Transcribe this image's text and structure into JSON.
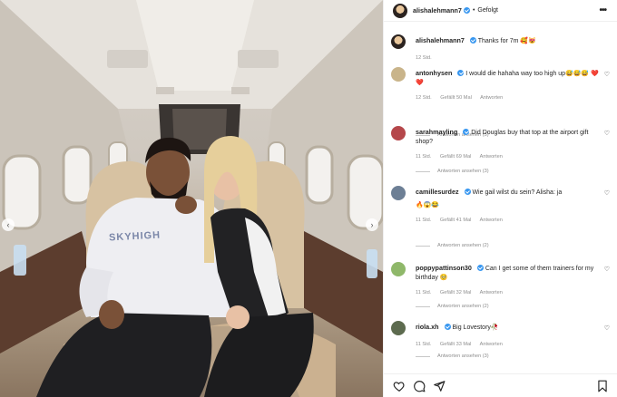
{
  "post": {
    "author": "alishalehmann7",
    "follow_status": "Gefolgt",
    "separator": "•",
    "more_icon": "more-options-icon",
    "shirt_print": "SKYHIGH"
  },
  "caption": {
    "user": "alishalehmann7",
    "text": "Thanks for 7m 🥰😻",
    "time": "12 Std."
  },
  "comments": [
    {
      "user": "antonhysen",
      "verified": true,
      "text": "I would die hahaha way too high up😅😅😅 ❤️❤️",
      "time": "12 Std.",
      "likes": "Gefällt 50 Mal",
      "reply": "Antworten",
      "view_replies": "Antworten ansehen (5)",
      "avatar_color": "#c9b48a"
    },
    {
      "user": "sarahmayling",
      "verified": true,
      "text": "Did Douglas buy that top at the airport gift shop?",
      "time": "11 Std.",
      "likes": "Gefällt 69 Mal",
      "reply": "Antworten",
      "view_replies": "Antworten ansehen (3)",
      "avatar_color": "#b5474b"
    },
    {
      "user": "camillesurdez",
      "verified": true,
      "text": "Wie gail wilst du sein? Alisha: ja",
      "extra": "🔥😱😂",
      "time": "11 Std.",
      "likes": "Gefällt 41 Mal",
      "reply": "Antworten",
      "view_replies": "Antworten ansehen (2)",
      "avatar_color": "#6d7f95"
    },
    {
      "user": "poppypattinson30",
      "verified": true,
      "text": "Can I get some of them trainers for my birthday 🥺",
      "time": "11 Std.",
      "likes": "Gefällt 32 Mal",
      "reply": "Antworten",
      "view_replies": "Antworten ansehen (2)",
      "avatar_color": "#8fb86a"
    },
    {
      "user": "riola.xh",
      "verified": true,
      "text": "Big Lovestory🥀",
      "time": "11 Std.",
      "likes": "Gefällt 33 Mal",
      "reply": "Antworten",
      "view_replies": "Antworten ansehen (3)",
      "avatar_color": "#5d6b4f"
    }
  ],
  "actions": {
    "like_icon": "heart-icon",
    "comment_icon": "comment-icon",
    "share_icon": "send-icon",
    "save_icon": "bookmark-icon"
  },
  "colors": {
    "verified": "#3897f0",
    "meta_text": "#8e8e8e",
    "text": "#262626"
  }
}
